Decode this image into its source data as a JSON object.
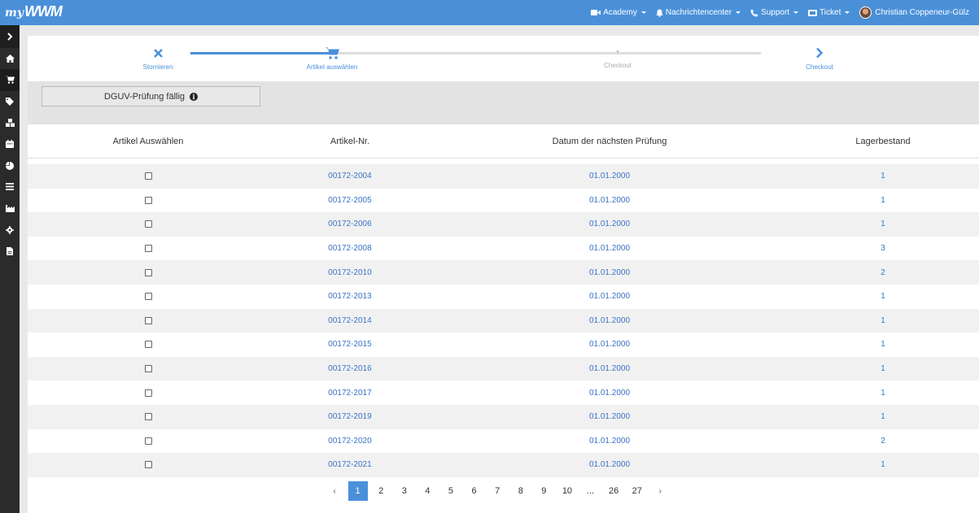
{
  "brand": {
    "my": "my",
    "name": "WWM"
  },
  "topnav": {
    "academy": "Academy",
    "notifications": "Nachrichtencenter",
    "support": "Support",
    "ticket": "Ticket",
    "user": "Christian Coppeneur-Gülz"
  },
  "sidebar": {
    "items": [
      "home-icon",
      "cart-icon",
      "tags-icon",
      "cubes-icon",
      "calendar-icon",
      "pie-chart-icon",
      "list-icon",
      "industry-icon",
      "gear-icon",
      "file-icon"
    ]
  },
  "stepper": {
    "steps": [
      {
        "label": "Stornieren",
        "icon": "close-icon"
      },
      {
        "label": "Artikel auswählen",
        "icon": "cart-icon"
      },
      {
        "label": "Checkout",
        "icon": "dot-icon"
      },
      {
        "label": "Checkout",
        "icon": "chevron-right-icon"
      }
    ],
    "progress": 0.25
  },
  "filter": {
    "dguv_label": "DGUV-Prüfung fällig"
  },
  "table": {
    "headers": [
      "Artikel Auswählen",
      "Artikel-Nr.",
      "Datum der nächsten Prüfung",
      "Lagerbestand"
    ],
    "rows": [
      {
        "nr": "00172-2004",
        "date": "01.01.2000",
        "stock": "1"
      },
      {
        "nr": "00172-2005",
        "date": "01.01.2000",
        "stock": "1"
      },
      {
        "nr": "00172-2006",
        "date": "01.01.2000",
        "stock": "1"
      },
      {
        "nr": "00172-2008",
        "date": "01.01.2000",
        "stock": "3"
      },
      {
        "nr": "00172-2010",
        "date": "01.01.2000",
        "stock": "2"
      },
      {
        "nr": "00172-2013",
        "date": "01.01.2000",
        "stock": "1"
      },
      {
        "nr": "00172-2014",
        "date": "01.01.2000",
        "stock": "1"
      },
      {
        "nr": "00172-2015",
        "date": "01.01.2000",
        "stock": "1"
      },
      {
        "nr": "00172-2016",
        "date": "01.01.2000",
        "stock": "1"
      },
      {
        "nr": "00172-2017",
        "date": "01.01.2000",
        "stock": "1"
      },
      {
        "nr": "00172-2019",
        "date": "01.01.2000",
        "stock": "1"
      },
      {
        "nr": "00172-2020",
        "date": "01.01.2000",
        "stock": "2"
      },
      {
        "nr": "00172-2021",
        "date": "01.01.2000",
        "stock": "1"
      }
    ]
  },
  "pagination": {
    "prev": "‹",
    "next": "›",
    "pages": [
      "1",
      "2",
      "3",
      "4",
      "5",
      "6",
      "7",
      "8",
      "9",
      "10",
      "...",
      "26",
      "27"
    ],
    "current": "1"
  },
  "colors": {
    "accent": "#4a90d9",
    "link": "#3a74c4",
    "sidebar": "#2b2b2b"
  }
}
